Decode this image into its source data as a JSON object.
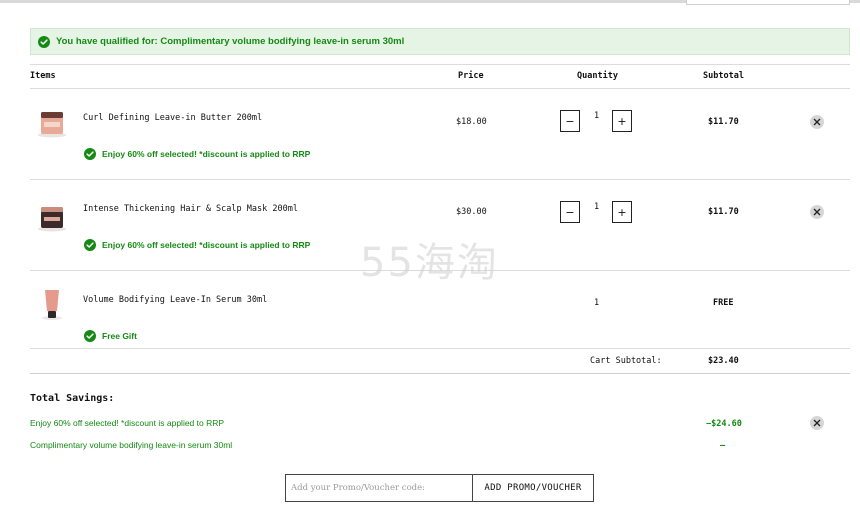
{
  "banner": {
    "text": "You have qualified for: Complimentary volume bodifying leave-in serum 30ml"
  },
  "table": {
    "headers": {
      "items": "Items",
      "price": "Price",
      "quantity": "Quantity",
      "subtotal": "Subtotal"
    },
    "rows": [
      {
        "name": "Curl Defining Leave-in Butter 200ml",
        "price": "$18.00",
        "quantity": "1",
        "subtotal": "$11.70",
        "promo": "Enjoy 60% off selected! *discount is applied to RRP",
        "quantity_minus": "−",
        "quantity_plus": "+"
      },
      {
        "name": "Intense Thickening Hair & Scalp Mask 200ml",
        "price": "$30.00",
        "quantity": "1",
        "subtotal": "$11.70",
        "promo": "Enjoy 60% off selected! *discount is applied to RRP",
        "quantity_minus": "−",
        "quantity_plus": "+"
      },
      {
        "name": "Volume Bodifying Leave-In Serum 30ml",
        "price": "",
        "quantity": "1",
        "subtotal": "FREE",
        "promo": "Free Gift"
      }
    ]
  },
  "cart": {
    "subtotal_label": "Cart Subtotal:",
    "subtotal_value": "$23.40"
  },
  "savings": {
    "title": "Total Savings:",
    "lines": [
      {
        "label": "Enjoy 60% off selected! *discount is applied to RRP",
        "value": "−$24.60"
      },
      {
        "label": "Complimentary volume bodifying leave-in serum 30ml",
        "value": "–"
      }
    ]
  },
  "voucher": {
    "placeholder": "Add your Promo/Voucher code:",
    "button_label": "ADD PROMO/VOUCHER"
  },
  "watermark": "55海淘",
  "colors": {
    "accent_green": "#148a14",
    "banner_bg": "#e6f4e6"
  }
}
